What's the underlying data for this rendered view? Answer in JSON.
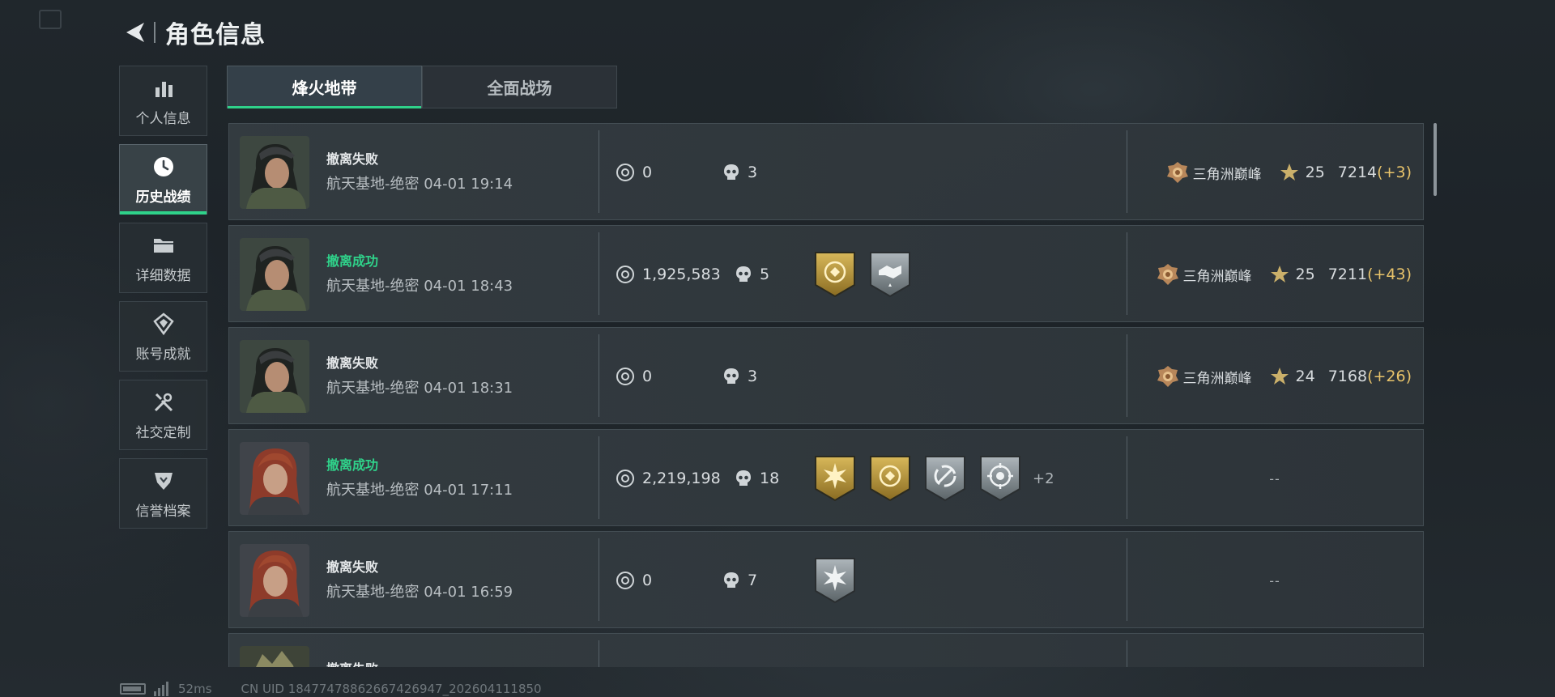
{
  "header": {
    "title": "角色信息"
  },
  "sidebar": {
    "items": [
      {
        "label": "个人信息",
        "icon": "bar-chart-icon",
        "active": false
      },
      {
        "label": "历史战绩",
        "icon": "clock-icon",
        "active": true
      },
      {
        "label": "详细数据",
        "icon": "folder-icon",
        "active": false
      },
      {
        "label": "账号成就",
        "icon": "achievement-icon",
        "active": false
      },
      {
        "label": "社交定制",
        "icon": "tools-icon",
        "active": false
      },
      {
        "label": "信誉档案",
        "icon": "shield-heart-icon",
        "active": false
      }
    ]
  },
  "tabs": [
    {
      "label": "烽火地带",
      "active": true
    },
    {
      "label": "全面战场",
      "active": false
    }
  ],
  "records": [
    {
      "status": "撤离失败",
      "success": false,
      "map": "航天基地-绝密 04-01 19:14",
      "money": "0",
      "kills": "3",
      "badges": [],
      "more": "",
      "rank_name": "三角洲巅峰",
      "level": "25",
      "score": "7214",
      "delta": "(+3)",
      "avatar": "female-dark"
    },
    {
      "status": "撤离成功",
      "success": true,
      "map": "航天基地-绝密 04-01 18:43",
      "money": "1,925,583",
      "kills": "5",
      "badges": [
        "gold-emblem-badge",
        "silver-handshake-badge"
      ],
      "more": "",
      "rank_name": "三角洲巅峰",
      "level": "25",
      "score": "7211",
      "delta": "(+43)",
      "avatar": "female-dark"
    },
    {
      "status": "撤离失败",
      "success": false,
      "map": "航天基地-绝密 04-01 18:31",
      "money": "0",
      "kills": "3",
      "badges": [],
      "more": "",
      "rank_name": "三角洲巅峰",
      "level": "24",
      "score": "7168",
      "delta": "(+26)",
      "avatar": "female-dark"
    },
    {
      "status": "撤离成功",
      "success": true,
      "map": "航天基地-绝密 04-01 17:11",
      "money": "2,219,198",
      "kills": "18",
      "badges": [
        "gold-burst-badge",
        "gold-emblem-badge",
        "silver-cycle-badge",
        "silver-target-badge"
      ],
      "more": "+2",
      "rank_name": "",
      "level": "",
      "score": "",
      "delta": "",
      "rank_empty": "--",
      "avatar": "female-red"
    },
    {
      "status": "撤离失败",
      "success": false,
      "map": "航天基地-绝密 04-01 16:59",
      "money": "0",
      "kills": "7",
      "badges": [
        "silver-burst-badge"
      ],
      "more": "",
      "rank_name": "",
      "level": "",
      "score": "",
      "delta": "",
      "rank_empty": "--",
      "avatar": "female-red"
    },
    {
      "status": "撤离失败",
      "success": false,
      "map": "",
      "money": "",
      "kills": "",
      "badges": [],
      "more": "",
      "rank_name": "",
      "level": "",
      "score": "",
      "delta": "",
      "avatar": "soldier-armored"
    }
  ],
  "footer": {
    "latency": "52ms",
    "uid": "CN UID 18477478862667426947_202604111850"
  },
  "colors": {
    "accent": "#2fd28a",
    "gold": "#e8c36a",
    "panel": "#343c41"
  }
}
